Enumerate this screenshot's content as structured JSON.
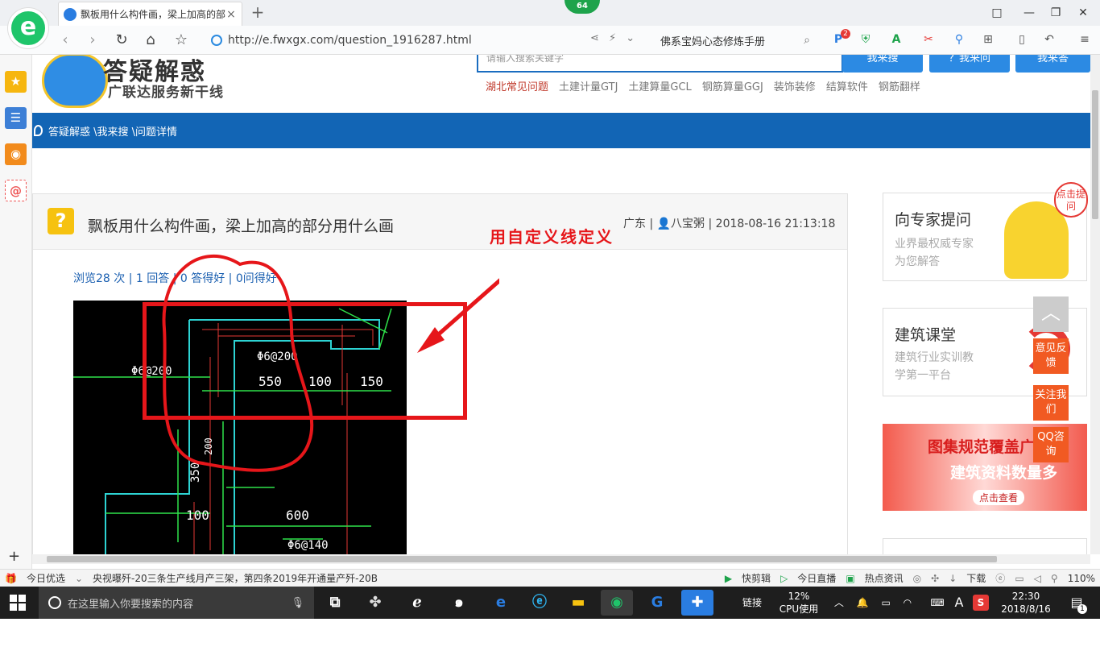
{
  "browser": {
    "tab_title": "飘板用什么构件画，梁上加高的部",
    "tab_close": "×",
    "new_tab": "+",
    "badge": "64",
    "url": "http://e.fwxgx.com/question_1916287.html",
    "search_text": "佛系宝妈心态修炼手册",
    "window_controls": [
      "□",
      "—",
      "❐",
      "✕"
    ],
    "toolbar_badge": "2"
  },
  "site": {
    "title": "答疑解惑",
    "subtitle": "广联达服务新干线",
    "search_placeholder": "请输入搜索关键字",
    "search_buttons": [
      "我来搜",
      "？我来问",
      "我来答"
    ],
    "nav_links": [
      "湖北常见问题",
      "土建计量GTJ",
      "土建算量GCL",
      "钢筋算量GGJ",
      "装饰装修",
      "结算软件",
      "钢筋翻样"
    ],
    "breadcrumb": "答疑解惑 \\我来搜 \\问题详情"
  },
  "question": {
    "title": "飘板用什么构件画，梁上加高的部分用什么画",
    "meta": "广东 | 👤八宝粥 | 2018-08-16 21:13:18",
    "stats": "浏览28 次 | 1 回答 | 0 答得好 | 0问得好",
    "annotation": "用自定义线定义",
    "cad_labels": [
      "Φ6@200",
      "Φ6@200",
      "550",
      "100",
      "150",
      "200",
      "350",
      "100",
      "600",
      "Φ6@140"
    ]
  },
  "sidebar_cards": [
    {
      "title": "向专家提问",
      "sub": [
        "业界最权威专家",
        "为您解答"
      ],
      "bubble": "点击提问"
    },
    {
      "title": "建筑课堂",
      "sub": [
        "建筑行业实训教",
        "学第一平台"
      ]
    }
  ],
  "ad": {
    "line1": "图集规范覆盖广",
    "line2": "建筑资料数量多",
    "button": "点击查看"
  },
  "floating": [
    "意见反馈",
    "关注我们",
    "QQ咨询"
  ],
  "status_bar": {
    "left": "今日优选",
    "news": "央视曝歼-20三条生产线月产三架，第四条2019年开通量产歼-20B",
    "items": [
      "快剪辑",
      "今日直播",
      "热点资讯",
      "下载"
    ],
    "zoom": "110%"
  },
  "taskbar": {
    "search_placeholder": "在这里输入你要搜索的内容",
    "link_label": "链接",
    "cpu_percent": "12%",
    "cpu_label": "CPU使用",
    "ime": "A",
    "time": "22:30",
    "date": "2018/8/16",
    "notif_count": "1"
  }
}
